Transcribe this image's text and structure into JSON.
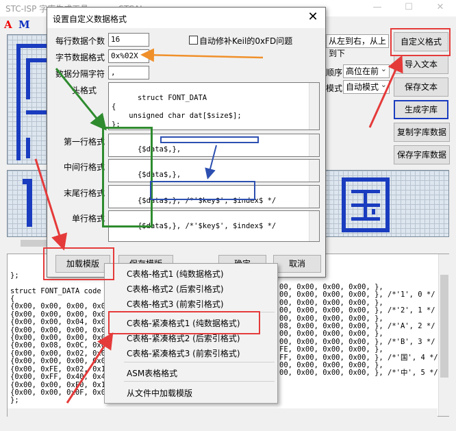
{
  "app": {
    "title": "STC-ISP 字库生成工具 - www.STCAI.com",
    "tools": {
      "font_a": "A",
      "font_m": "M"
    },
    "window_buttons": {
      "minimize": "—",
      "maximize": "☐",
      "close": "✕"
    }
  },
  "options": {
    "scan_mode": "从左到右，从上到下",
    "order_label": "顺序",
    "order_value": "高位在前",
    "mode_label": "模式",
    "mode_value": "自动模式"
  },
  "side_buttons": {
    "custom_format": "自定义格式",
    "import_text": "导入文本",
    "save_text": "保存文本",
    "generate": "生成字库",
    "copy_data": "复制字库数据",
    "save_data": "保存字库数据"
  },
  "dialog": {
    "title": "设置自定义数据格式",
    "close": "✕",
    "fields": {
      "per_line_label": "每行数据个数",
      "per_line_value": "16",
      "auto_fix_label": "自动修补Keil的0xFD问题",
      "byte_format_label": "字节数据格式",
      "byte_format_value": "0x%02X",
      "separator_label": "数据分隔字符",
      "separator_value": ",",
      "header_label": "头格式",
      "header_value": "struct FONT_DATA\n{\n    unsigned char dat[$size$];\n};\n\nconst struct FONT_DATA code Font_Data[] =",
      "first_line_label": "第一行格式",
      "first_line_value": "{$data$,},",
      "middle_line_label": "中间行格式",
      "middle_line_value": "{$data$,},",
      "last_line_label": "末尾行格式",
      "last_line_value": "{$data$,}, /*'$key$', $index$ */",
      "single_line_label": "单行格式",
      "single_line_value": "{$data$,}, /*'$key$', $index$ */"
    },
    "buttons": {
      "load_template": "加载模版",
      "save_template": "保存模版",
      "ok": "确定",
      "cancel": "取消"
    }
  },
  "menu": {
    "items": [
      "C表格-格式1 (纯数据格式)",
      "C表格-格式2 (后索引格式)",
      "C表格-格式3 (前索引格式)",
      "C表格-紧凑格式1 (纯数据格式)",
      "C表格-紧凑格式2 (后索引格式)",
      "C表格-紧凑格式3 (前索引格式)",
      "ASM表格格式",
      "从文件中加载模版"
    ]
  },
  "output": {
    "lines_left": [
      "};",
      "",
      "struct FONT_DATA code F",
      "{",
      "{0x00, 0x00, 0x00, 0x00, 0x",
      "{0x00, 0x00, 0x00, 0x00, 0x",
      "{0x00, 0x00, 0x04, 0x00, 0x",
      "{0x00, 0x00, 0x00, 0x08, 0x",
      "{0x00, 0x00, 0x00, 0x00, 0x",
      "{0x00, 0x08, 0x0C, 0x0B, 0x",
      "{0x00, 0x00, 0x02, 0x00, 0x",
      "{0x00, 0x00, 0x00, 0x08, 0x",
      "{0x00, 0xFE, 0x02, 0x12, 0x",
      "{0x00, 0xFF, 0x40, 0x48, 0x",
      "{0x00, 0x00, 0xF0, 0x10, 0x",
      "{0x00, 0x00, 0x0F, 0x04, 0x",
      "};"
    ],
    "lines_right": [
      "00, 0x00, 0x00, 0x00, },",
      "00, 0x00, 0x00, 0x00, }, /*'1', 0 */",
      "00, 0x00, 0x00, 0x00, },",
      "00, 0x00, 0x00, 0x00, }, /*'2', 1 */",
      "00, 0x00, 0x00, 0x00, },",
      "08, 0x00, 0x00, 0x00, }, /*'A', 2 */",
      "00, 0x00, 0x00, 0x00, },",
      "00, 0x00, 0x00, 0x00, }, /*'B', 3 */",
      "FE, 0x00, 0x00, 0x00, },",
      "FF, 0x00, 0x00, 0x00, }, /*'国', 4 */",
      "00, 0x00, 0x00, 0x00, },",
      "00, 0x00, 0x00, 0x00, }, /*'中', 5 */"
    ]
  },
  "colors": {
    "annotation_red": "#e53a3a",
    "annotation_green": "#2e8b2e",
    "annotation_blue": "#2c4fb0",
    "annotation_orange": "#f0902a",
    "pixel": "#1a3cbf"
  }
}
